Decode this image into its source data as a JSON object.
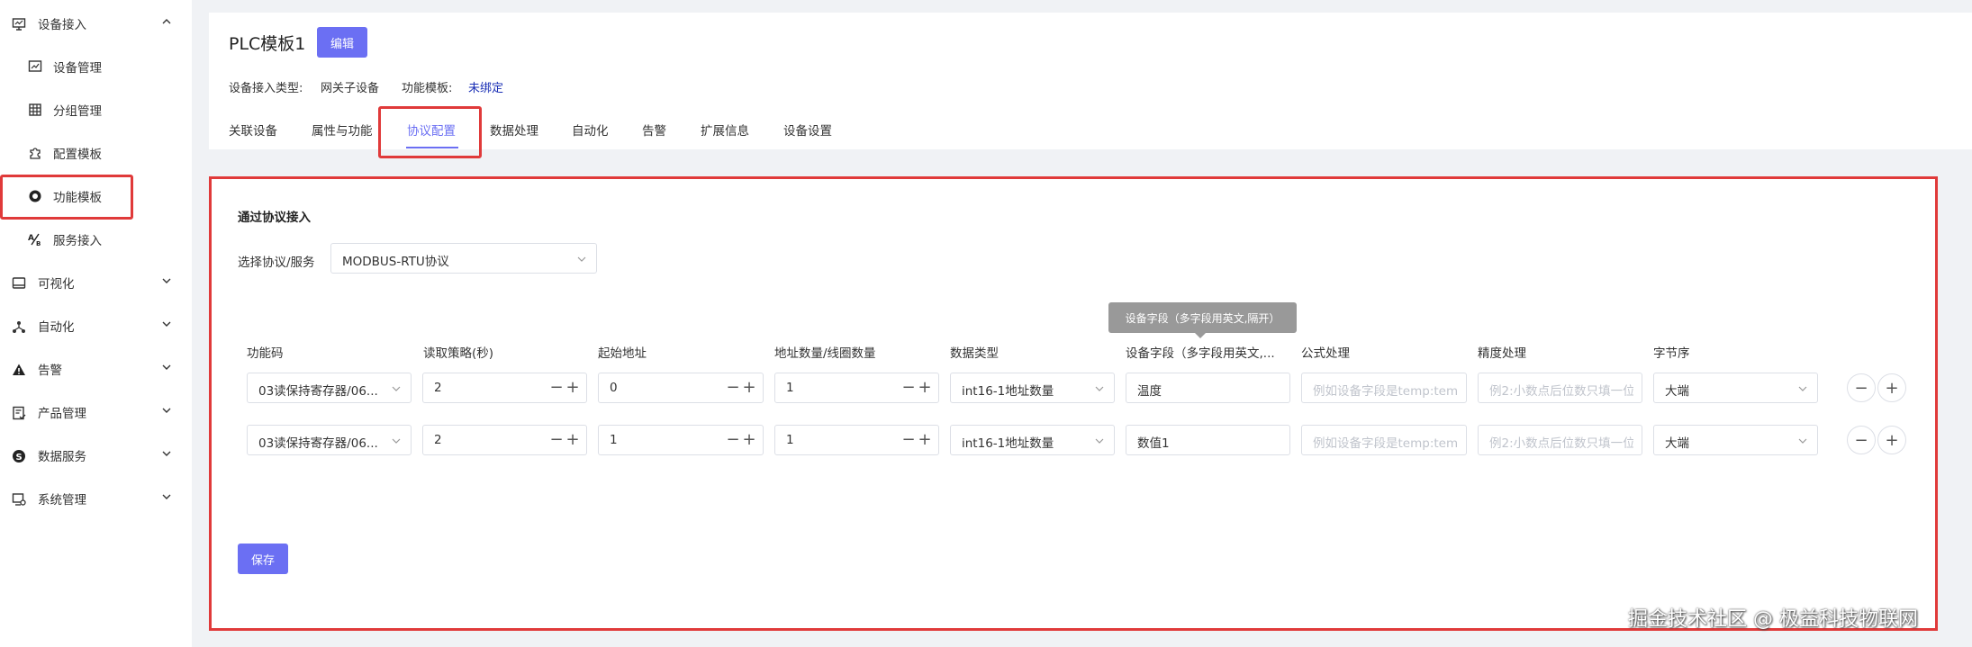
{
  "sidebar": {
    "groups": [
      {
        "label": "设备接入",
        "icon": "monitor-icon",
        "expanded": true
      },
      {
        "label": "可视化",
        "icon": "screen-icon"
      },
      {
        "label": "自动化",
        "icon": "network-icon"
      },
      {
        "label": "告警",
        "icon": "warning-icon"
      },
      {
        "label": "产品管理",
        "icon": "product-icon"
      },
      {
        "label": "数据服务",
        "icon": "data-service-icon"
      },
      {
        "label": "系统管理",
        "icon": "system-icon"
      }
    ],
    "sub_items": [
      {
        "label": "设备管理",
        "icon": "device-chart-icon"
      },
      {
        "label": "分组管理",
        "icon": "grid-icon"
      },
      {
        "label": "配置模板",
        "icon": "puzzle-icon"
      },
      {
        "label": "功能模板",
        "icon": "function-icon"
      },
      {
        "label": "服务接入",
        "icon": "service-icon"
      }
    ]
  },
  "header": {
    "title": "PLC模板1",
    "edit_label": "编辑",
    "access_type_label": "设备接入类型:",
    "access_type_value": "网关子设备",
    "func_template_label": "功能模板:",
    "func_template_value": "未绑定"
  },
  "tabs": [
    "关联设备",
    "属性与功能",
    "协议配置",
    "数据处理",
    "自动化",
    "告警",
    "扩展信息",
    "设备设置"
  ],
  "active_tab": "协议配置",
  "config": {
    "section_title": "通过协议接入",
    "protocol_label": "选择协议/服务",
    "protocol_value": "MODBUS-RTU协议",
    "tooltip": "设备字段（多字段用英文,隔开）",
    "columns": [
      "功能码",
      "读取策略(秒)",
      "起始地址",
      "地址数量/线圈数量",
      "数据类型",
      "设备字段（多字段用英文,...",
      "公式处理",
      "精度处理",
      "字节序"
    ],
    "formula_placeholder": "例如设备字段是temp:temp",
    "precision_placeholder": "例2:小数点后位数只填一位",
    "rows": [
      {
        "func_code": "03读保持寄存器/06...",
        "strategy": "2",
        "start_addr": "0",
        "count": "1",
        "data_type": "int16-1地址数量",
        "field": "温度",
        "byte_order": "大端"
      },
      {
        "func_code": "03读保持寄存器/06...",
        "strategy": "2",
        "start_addr": "1",
        "count": "1",
        "data_type": "int16-1地址数量",
        "field": "数值1",
        "byte_order": "大端"
      }
    ],
    "save_label": "保存"
  },
  "watermark": "掘金技术社区 @ 极益科技物联网",
  "colors": {
    "accent": "#6b6ff3",
    "highlight": "#e03a3a",
    "link": "#1a2fb5"
  }
}
